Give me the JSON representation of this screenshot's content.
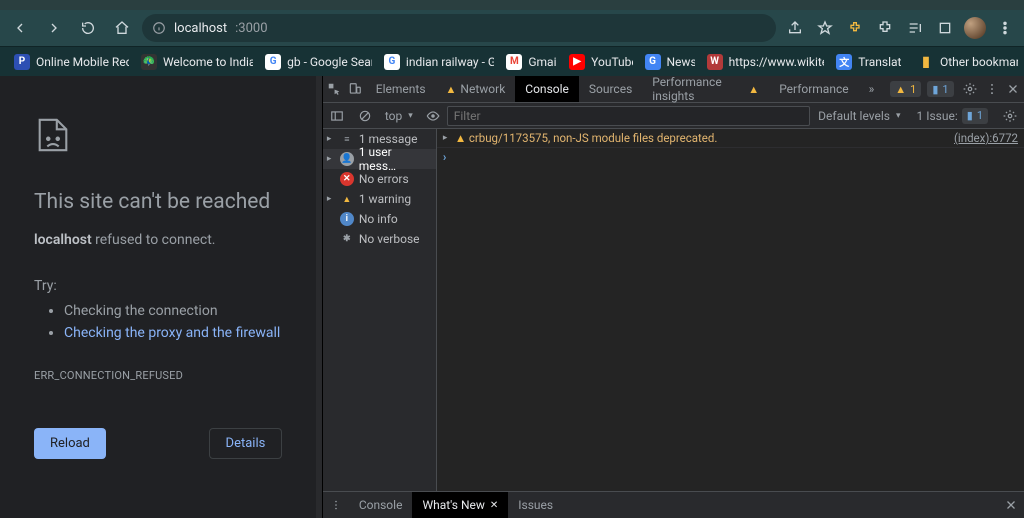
{
  "chrome": {
    "url_prefix_icon": "info",
    "url_host": "localhost",
    "url_port": ":3000",
    "right_icons": [
      "share",
      "star",
      "puzzle-warn",
      "extensions",
      "reading-list",
      "window",
      "avatar",
      "menu"
    ]
  },
  "bookmarks": {
    "items": [
      {
        "label": "Online Mobile Rech…",
        "bg": "#2d4fb3",
        "ch": "P"
      },
      {
        "label": "Welcome to Indian…",
        "bg": "#8b5a2b",
        "ch": "🦅"
      },
      {
        "label": "gb - Google Search",
        "bg": "#ffffff",
        "ch": "G"
      },
      {
        "label": "indian railway - Go…",
        "bg": "#ffffff",
        "ch": "G"
      },
      {
        "label": "Gmail",
        "bg": "#ffffff",
        "ch": "M"
      },
      {
        "label": "YouTube",
        "bg": "#ff0000",
        "ch": "▶"
      },
      {
        "label": "News",
        "bg": "#4285f4",
        "ch": "G"
      },
      {
        "label": "https://www.wikitec…",
        "bg": "#b23a3a",
        "ch": "W"
      },
      {
        "label": "Translate",
        "bg": "#4285f4",
        "ch": "🔤"
      }
    ],
    "other": "Other bookmarks"
  },
  "error": {
    "title": "This site can't be reached",
    "host": "localhost",
    "refused": " refused to connect.",
    "try": "Try:",
    "li1": "Checking the connection",
    "li2": "Checking the proxy and the firewall",
    "code": "ERR_CONNECTION_REFUSED",
    "reload": "Reload",
    "details": "Details"
  },
  "devtools": {
    "tabs": {
      "elements": "Elements",
      "network": "Network",
      "console": "Console",
      "sources": "Sources",
      "perf_insights": "Performance insights",
      "performance": "Performance"
    },
    "badges": {
      "warn": "1",
      "info": "1"
    },
    "toolbar": {
      "top": "top",
      "filter": "Filter",
      "levels": "Default levels",
      "issue": "1 Issue:",
      "issue_count": "1"
    },
    "sidebar": {
      "messages": "1 message",
      "usermess": "1 user mess…",
      "noerrors": "No errors",
      "warning": "1 warning",
      "noinfo": "No info",
      "noverbose": "No verbose"
    },
    "console": {
      "warn_text": "crbug/1173575, non-JS module files deprecated.",
      "warn_loc": "(index):6772"
    },
    "drawer": {
      "console": "Console",
      "whatsnew": "What's New",
      "issues": "Issues"
    }
  }
}
